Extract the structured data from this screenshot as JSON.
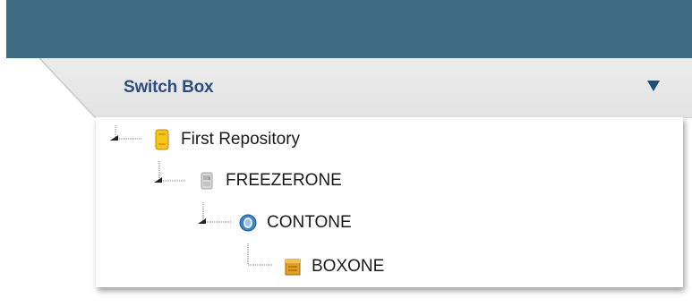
{
  "panel": {
    "title": "Switch Box",
    "dropdown_icon": "triangle-down-icon"
  },
  "tree": {
    "nodes": [
      {
        "label": "First Repository",
        "icon": "repository-icon",
        "level": 0
      },
      {
        "label": "FREEZERONE",
        "icon": "freezer-icon",
        "level": 1
      },
      {
        "label": "CONTONE",
        "icon": "container-icon",
        "level": 2
      },
      {
        "label": "BOXONE",
        "icon": "box-icon",
        "level": 3
      }
    ]
  },
  "colors": {
    "topbar": "#3e6b82",
    "title": "#2c4d83",
    "arrow": "#1f4f72"
  }
}
